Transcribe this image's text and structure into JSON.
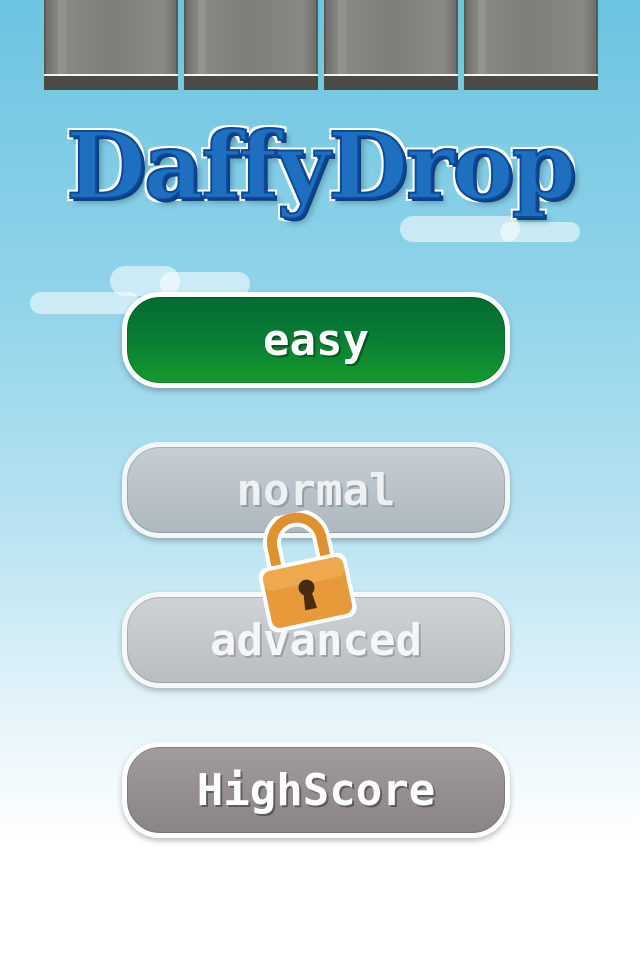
{
  "logo": {
    "text": "DaffyDrop"
  },
  "menu": {
    "easy_label": "easy",
    "normal_label": "normal",
    "advanced_label": "advanced",
    "highscore_label": "HighScore"
  },
  "icons": {
    "lock": "padlock-icon"
  },
  "colors": {
    "easy_button": "#0a7e35",
    "locked_button": "#bac3ca",
    "highscore_button": "#958f90",
    "logo_blue": "#1f6fc0",
    "lock_orange": "#e89a3a"
  }
}
